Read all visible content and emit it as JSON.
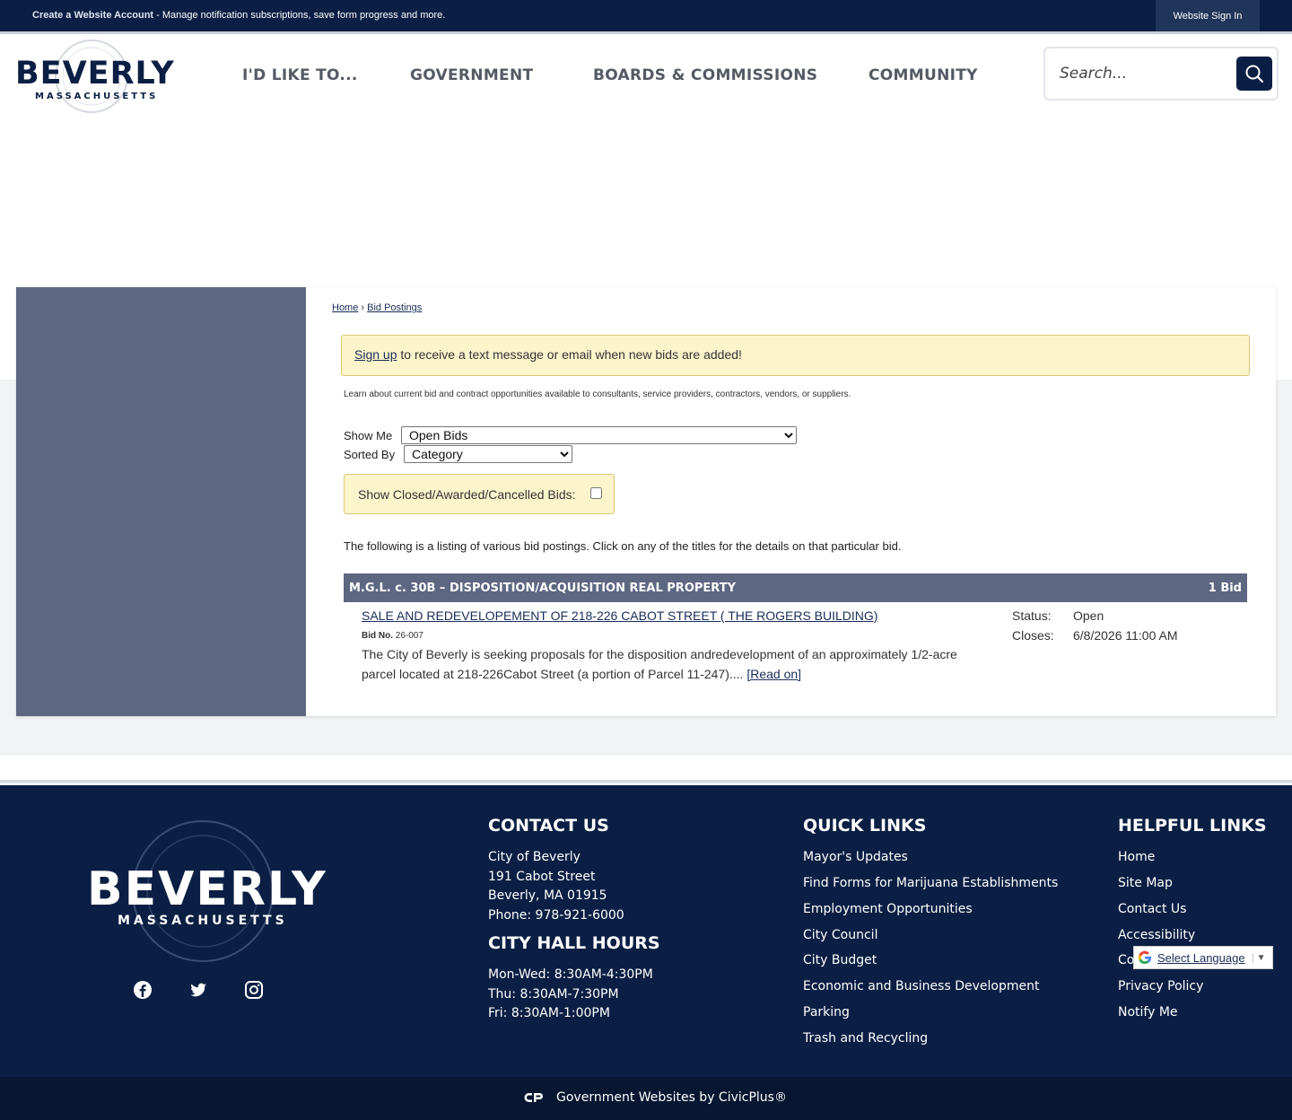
{
  "topbar": {
    "account_link": "Create a Website Account",
    "account_text": " - Manage notification subscriptions, save form progress and more.",
    "signin": "Website Sign In"
  },
  "header": {
    "logo_main": "BEVERLY",
    "logo_sub": "MASSACHUSETTS",
    "nav": [
      "I'D LIKE TO...",
      "GOVERNMENT",
      "BOARDS & COMMISSIONS",
      "COMMUNITY"
    ],
    "search_placeholder": "Search..."
  },
  "breadcrumb": {
    "home": "Home",
    "sep": " › ",
    "current": "Bid Postings"
  },
  "notice": {
    "link": "Sign up",
    "text": " to receive a text message or email when new bids are added!"
  },
  "intro": "Learn about current bid and contract opportunities available to consultants, service providers, contractors, vendors, or suppliers.",
  "filters": {
    "show_me_label": "Show Me",
    "show_me_value": "Open Bids",
    "sorted_by_label": "Sorted By",
    "sorted_by_value": "Category",
    "closed_label": "Show Closed/Awarded/Cancelled Bids:"
  },
  "listing_text": "The following is a listing of various bid postings. Click on any of the titles for the details on that particular bid.",
  "category": {
    "title": "M.G.L. c. 30B – DISPOSITION/ACQUISITION REAL PROPERTY",
    "count": "1 Bid"
  },
  "bid": {
    "title": "SALE AND REDEVELOPEMENT OF 218-226 CABOT STREET ( THE ROGERS BUILDING)",
    "number_label": "Bid No.",
    "number": "26-007",
    "description": "The City of Beverly is seeking proposals for the disposition andredevelopment of an approximately 1/2-acre parcel located at 218-226Cabot Street (a portion of Parcel 11-247).... ",
    "read_on": "[Read on]",
    "status_label": "Status:",
    "status_value": "Open",
    "closes_label": "Closes:",
    "closes_value": "6/8/2026 11:00 AM"
  },
  "footer": {
    "contact_heading": "CONTACT US",
    "contact_lines": [
      "City of Beverly",
      "191 Cabot Street",
      "Beverly, MA 01915",
      "Phone: 978-921-6000"
    ],
    "hours_heading": "CITY HALL HOURS",
    "hours_lines": [
      "Mon-Wed: 8:30AM-4:30PM",
      "Thu: 8:30AM-7:30PM",
      "Fri: 8:30AM-1:00PM"
    ],
    "quick_heading": "QUICK LINKS",
    "quick_links": [
      "Mayor's Updates",
      "Find Forms for Marijuana Establishments",
      "Employment Opportunities",
      "City Council",
      "City Budget",
      "Economic and Business Development",
      "Parking",
      "Trash and Recycling"
    ],
    "helpful_heading": "HELPFUL LINKS",
    "helpful_links": [
      "Home",
      "Site Map",
      "Contact Us",
      "Accessibility",
      "Co",
      "Privacy Policy",
      "Notify Me"
    ],
    "translate_label": "Select Language",
    "translate_arrow": "▼",
    "civic_text": "Government Websites by CivicPlus®"
  },
  "colors": {
    "navy": "#0b1f44",
    "slate": "#5e6782",
    "notice_bg": "#fcf5cc"
  }
}
